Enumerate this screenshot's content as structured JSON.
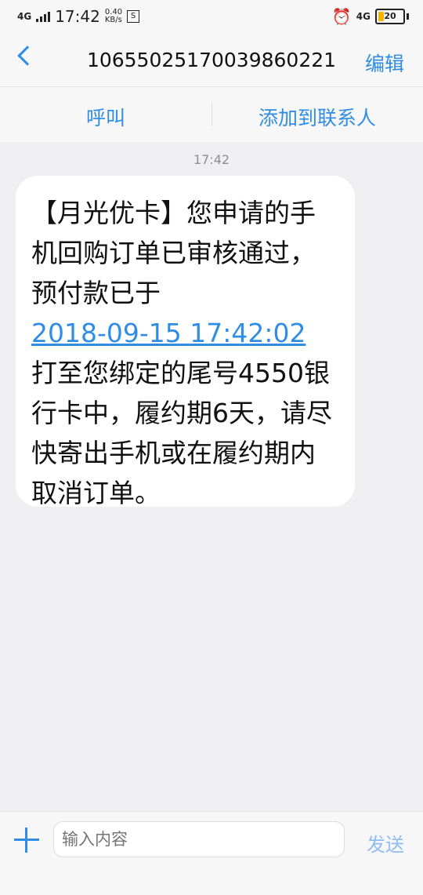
{
  "status_bar": {
    "network_left": "4G",
    "time": "17:42",
    "speed_value": "0.40",
    "speed_unit": "KB/s",
    "status_icon_text": "S",
    "network_right": "4G",
    "battery_level": "20",
    "battery_color": "#f4b400"
  },
  "header": {
    "title": "10655025170039860221",
    "edit_label": "编辑",
    "back_icon": "back-chevron-icon"
  },
  "actions": {
    "call_label": "呼叫",
    "add_contact_label": "添加到联系人"
  },
  "conversation": {
    "timestamp": "17:42",
    "message": {
      "text_before": "【月光优卡】您申请的手机回购订单已审核通过，预付款已于",
      "link_text": "2018-09-15 17:42:02",
      "text_after": "打至您绑定的尾号4550银行卡中，履约期6天，请尽快寄出手机或在履约期内取消订单。"
    }
  },
  "composer": {
    "placeholder": "输入内容",
    "send_label": "发送",
    "add_icon": "plus-icon"
  },
  "colors": {
    "accent": "#2f8de4",
    "background": "#efeff1",
    "bubble": "#ffffff"
  }
}
